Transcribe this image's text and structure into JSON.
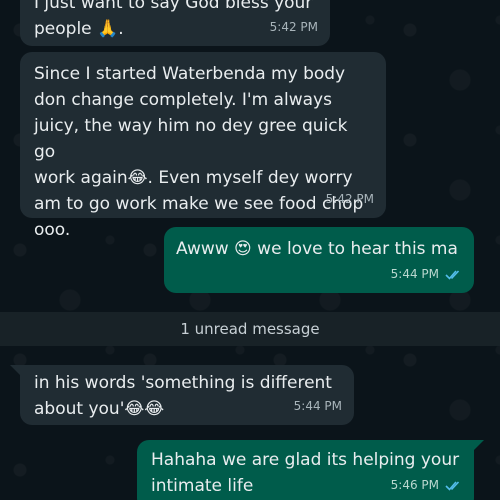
{
  "messages": [
    {
      "text": "I just want to say God bless your\npeople 🙏.",
      "time": "5:42 PM",
      "direction": "incoming"
    },
    {
      "text": "Since I started Waterbenda my body\ndon change completely. I'm always\njuicy, the way him no dey gree quick go\nwork again😂. Even myself dey worry\nam to go work make we see food chop\nooo.",
      "time": "5:42 PM",
      "direction": "incoming"
    },
    {
      "text": "Awww 😍 we love to hear this ma",
      "time": "5:44 PM",
      "direction": "outgoing",
      "status": "read"
    },
    {
      "text": "in his words 'something is different\nabout you'😂😂",
      "time": "5:44 PM",
      "direction": "incoming"
    },
    {
      "text": "Hahaha we are glad its helping your\nintimate life",
      "time": "5:46 PM",
      "direction": "outgoing",
      "status": "read"
    }
  ],
  "divider": {
    "label": "1 unread message"
  },
  "colors": {
    "background": "#0b141a",
    "incoming_bubble": "#202c33",
    "outgoing_bubble": "#005c4b",
    "read_ticks": "#53bdeb"
  },
  "icons": {
    "read_receipt": "double-check-icon"
  }
}
